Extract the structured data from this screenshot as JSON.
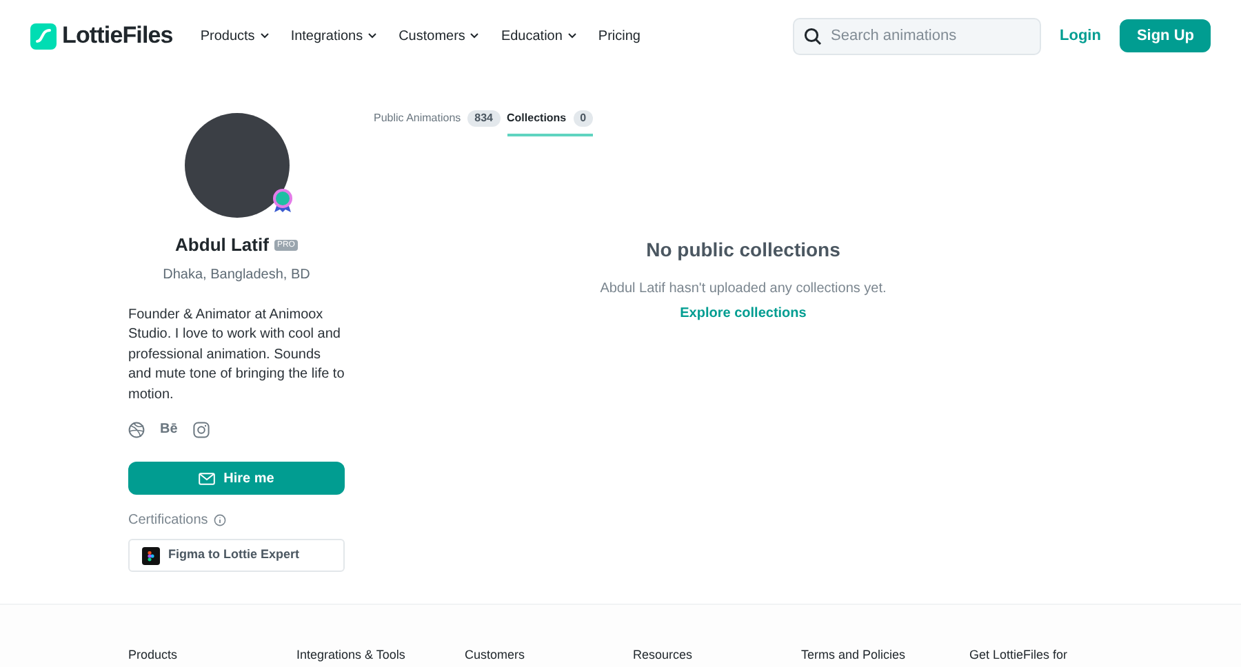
{
  "header": {
    "logo": "LottieFiles",
    "nav": [
      {
        "label": "Products",
        "dropdown": true
      },
      {
        "label": "Integrations",
        "dropdown": true
      },
      {
        "label": "Customers",
        "dropdown": true
      },
      {
        "label": "Education",
        "dropdown": true
      },
      {
        "label": "Pricing",
        "dropdown": false
      }
    ],
    "search": {
      "placeholder": "Search animations"
    },
    "login": "Login",
    "signup": "Sign Up"
  },
  "profile": {
    "name": "Abdul Latif",
    "badge": "PRO",
    "location": "Dhaka, Bangladesh, BD",
    "bio": "Founder & Animator at Animoox Studio. I love to work with cool and professional animation. Sounds and mute tone of bringing the life to motion.",
    "socials": [
      {
        "kind": "dribbble"
      },
      {
        "kind": "behance",
        "label": "Bē"
      },
      {
        "kind": "instagram"
      }
    ],
    "hire": "Hire me",
    "certifications_label": "Certifications",
    "certifications": [
      "Figma to Lottie Expert"
    ]
  },
  "tabs": [
    {
      "label": "Public Animations",
      "count": "834",
      "selected": false
    },
    {
      "label": "Collections",
      "count": "0",
      "selected": true
    }
  ],
  "empty": {
    "title": "No public collections",
    "message": "Abdul Latif hasn't uploaded any collections yet.",
    "link": "Explore collections"
  },
  "footer": {
    "headings": [
      "Products",
      "Integrations & Tools",
      "Customers",
      "Resources",
      "Terms and Policies",
      "Get LottieFiles for"
    ]
  }
}
